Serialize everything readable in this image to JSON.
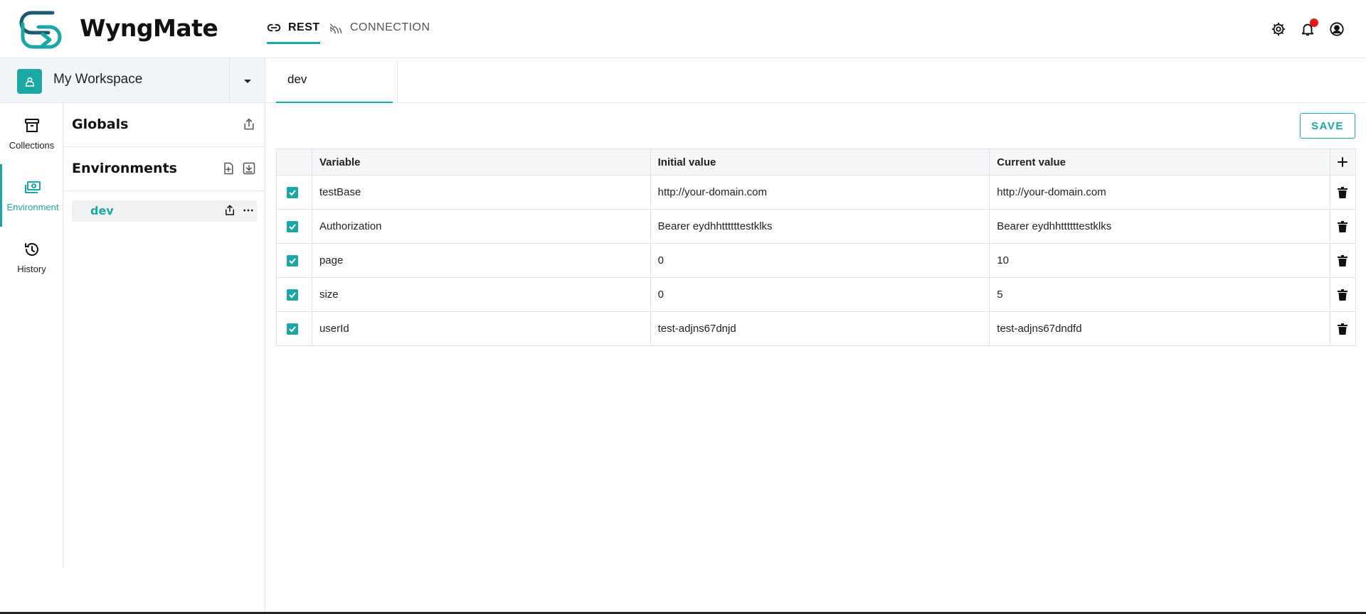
{
  "app": {
    "name": "WyngMate",
    "accent": "#1ba8a4"
  },
  "nav": {
    "rest": "REST",
    "connection": "CONNECTION"
  },
  "header_icons": [
    "gear-icon",
    "bell-icon",
    "account-icon"
  ],
  "workspace": {
    "name": "My Workspace"
  },
  "rail": {
    "items": [
      {
        "label": "Collections",
        "icon": "archive-icon"
      },
      {
        "label": "Environment",
        "icon": "money-icon",
        "active": true
      },
      {
        "label": "History",
        "icon": "history-icon"
      }
    ]
  },
  "panel": {
    "globals_title": "Globals",
    "environments_title": "Environments",
    "environments": [
      {
        "name": "dev",
        "selected": true
      }
    ]
  },
  "main": {
    "tab_label": "dev",
    "save_label": "SAVE",
    "columns": [
      "Variable",
      "Initial value",
      "Current value"
    ],
    "rows": [
      {
        "enabled": true,
        "variable": "testBase",
        "initial": "http://your-domain.com",
        "current": "http://your-domain.com"
      },
      {
        "enabled": true,
        "variable": "Authorization",
        "initial": "Bearer eydhhttttttestklks",
        "current": "Bearer eydhhttttttestklks"
      },
      {
        "enabled": true,
        "variable": "page",
        "initial": "0",
        "current": "10"
      },
      {
        "enabled": true,
        "variable": "size",
        "initial": "0",
        "current": "5"
      },
      {
        "enabled": true,
        "variable": "userId",
        "initial": "test-adjns67dnjd",
        "current": "test-adjns67dndfd"
      }
    ]
  }
}
